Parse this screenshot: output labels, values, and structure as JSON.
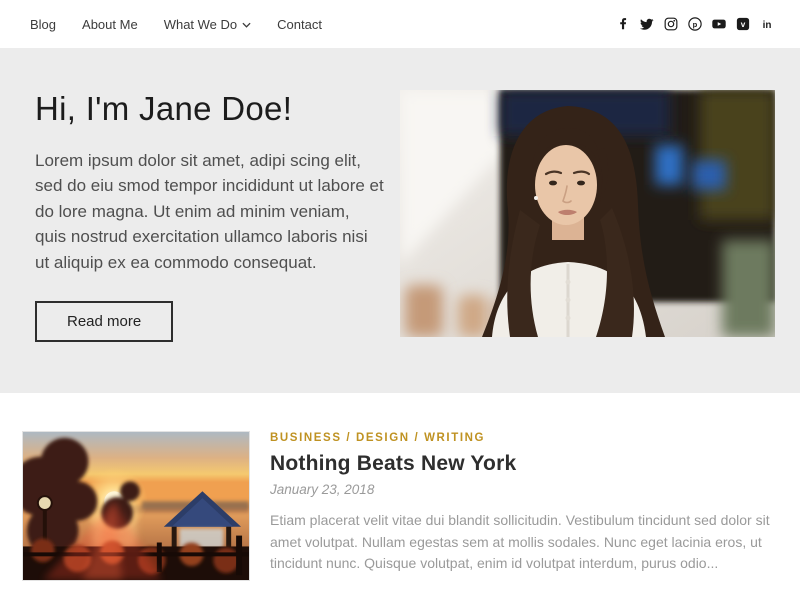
{
  "nav": {
    "items": [
      {
        "label": "Blog"
      },
      {
        "label": "About Me"
      },
      {
        "label": "What We Do",
        "icon": "chevron-down-icon"
      },
      {
        "label": "Contact"
      }
    ],
    "social_icons": [
      "facebook-icon",
      "twitter-icon",
      "instagram-icon",
      "pinterest-icon",
      "youtube-icon",
      "vimeo-icon",
      "linkedin-icon"
    ]
  },
  "hero": {
    "title": "Hi, I'm Jane Doe!",
    "body": "Lorem ipsum dolor sit amet, adipi scing elit, sed do eiu smod tempor incididunt ut labore et do lore magna. Ut enim ad minim veniam, quis nostrud exercitation ullamco laboris nisi ut aliquip ex ea commodo consequat.",
    "cta_label": "Read more",
    "image_alt": "portrait-of-jane-doe"
  },
  "post": {
    "categories": [
      "BUSINESS",
      "DESIGN",
      "WRITING"
    ],
    "category_separator": " / ",
    "title": "Nothing Beats New York",
    "date": "January 23, 2018",
    "excerpt": "Etiam placerat velit vitae dui blandit sollicitudin. Vestibulum tincidunt sed dolor sit amet volutpat. Nullam egestas sem at mollis sodales. Nunc eget lacinia eros, ut tincidunt nunc. Quisque volutpat, enim id volutpat interdum, purus odio...",
    "thumbnail_alt": "sunset-over-lake"
  },
  "colors": {
    "category_accent": "#bf9222",
    "hero_background": "#ececec",
    "text_dark": "#2e2e2e",
    "text_muted": "#9a9a9a"
  }
}
